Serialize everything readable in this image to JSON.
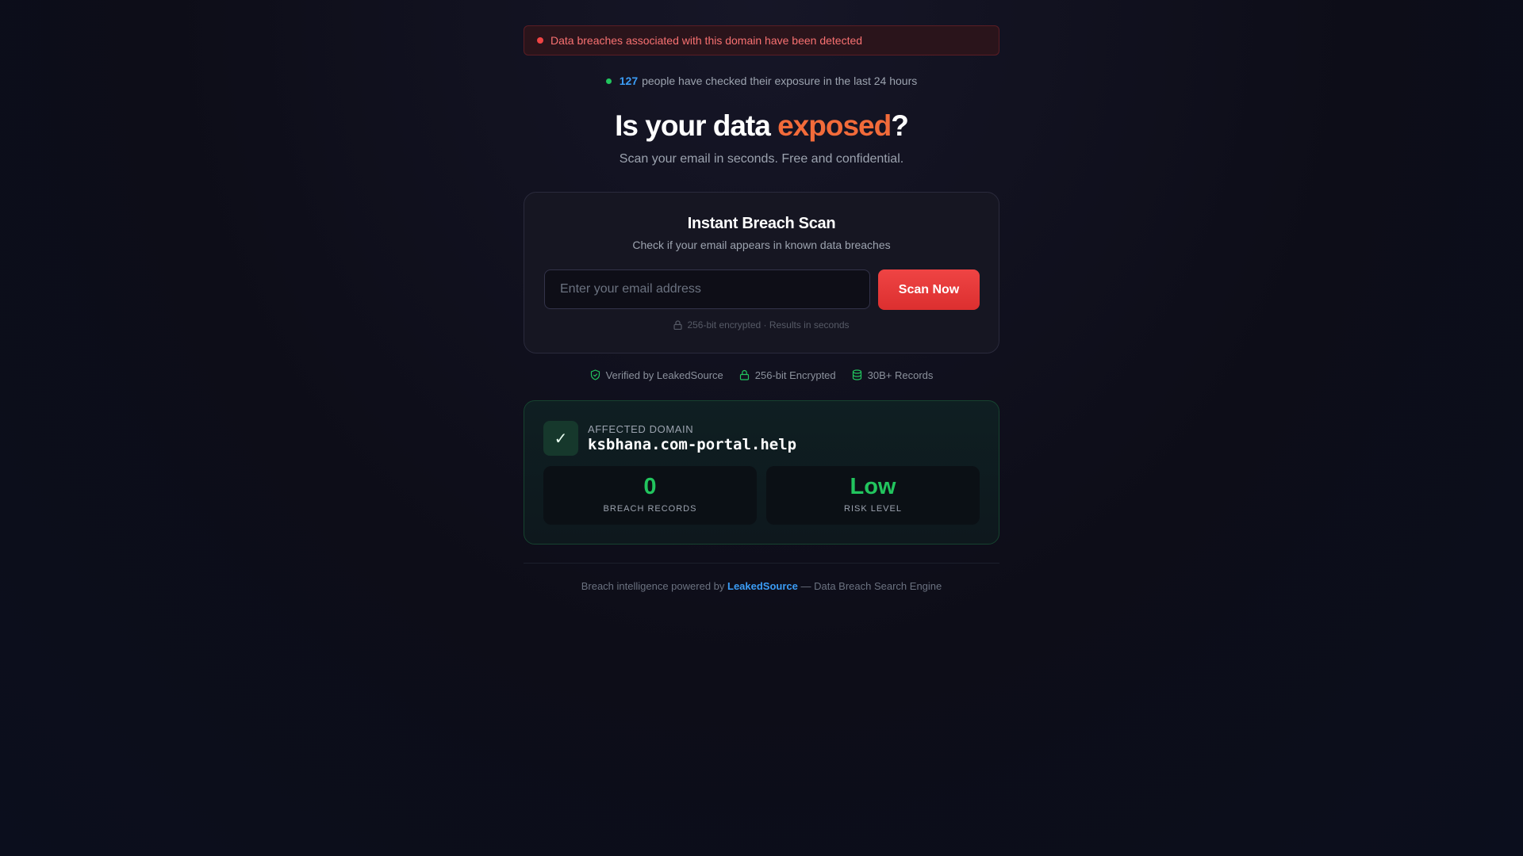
{
  "alert": {
    "text": "Data breaches associated with this domain have been detected"
  },
  "live": {
    "count": "127",
    "text": "people have checked their exposure in the last 24 hours"
  },
  "hero": {
    "title_pre": "Is your data ",
    "title_highlight": "exposed",
    "title_post": "?",
    "subtitle": "Scan your email in seconds. Free and confidential."
  },
  "scan_card": {
    "title": "Instant Breach Scan",
    "subtitle": "Check if your email appears in known data breaches",
    "email_placeholder": "Enter your email address",
    "button_label": "Scan Now",
    "note": "256-bit encrypted · Results in seconds"
  },
  "trust": [
    {
      "icon": "shield-check-icon",
      "label": "Verified by LeakedSource"
    },
    {
      "icon": "lock-icon",
      "label": "256-bit Encrypted"
    },
    {
      "icon": "database-icon",
      "label": "30B+ Records"
    }
  ],
  "domain_card": {
    "label": "AFFECTED DOMAIN",
    "domain": "ksbhana.com-portal.help",
    "stats": [
      {
        "value": "0",
        "caption": "BREACH RECORDS"
      },
      {
        "value": "Low",
        "caption": "RISK LEVEL"
      }
    ]
  },
  "footer": {
    "pre": "Breach intelligence powered by ",
    "link": "LeakedSource",
    "post": " — Data Breach Search Engine"
  },
  "colors": {
    "accent_red": "#ef4444",
    "accent_orange": "#f26b3a",
    "accent_green": "#22c55e",
    "accent_blue": "#3b9cf5"
  }
}
